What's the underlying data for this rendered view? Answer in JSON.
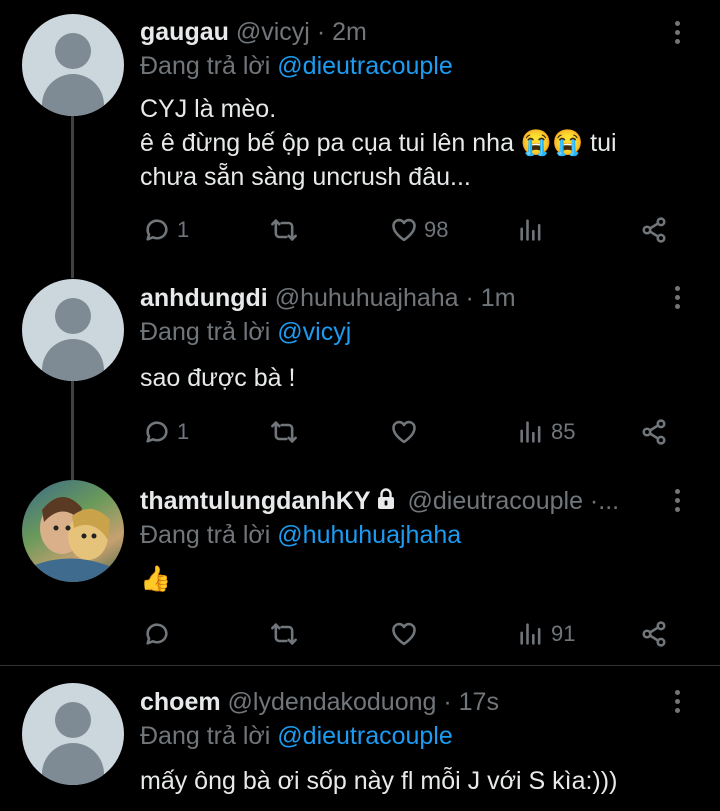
{
  "tweets": [
    {
      "name": "gaugau",
      "handle": "@vicyj",
      "time": "· 2m",
      "reply_prefix": "Đang trả lời ",
      "reply_to": "@dieutracouple",
      "text_lines": [
        "CYJ là mèo.",
        "ê ê đừng bế ộp pa cụa tui lên nha 😭😭 tui",
        "chưa sẵn sàng uncrush đâu..."
      ],
      "replies": "1",
      "likes": "98",
      "views": ""
    },
    {
      "name": "anhdungdi",
      "handle": "@huhuhuajhaha",
      "time": "· 1m",
      "reply_prefix": "Đang trả lời ",
      "reply_to": "@vicyj",
      "text_lines": [
        "sao được bà !"
      ],
      "replies": "1",
      "likes": "",
      "views": "85"
    },
    {
      "name": "thamtulungdanhKY",
      "handle": "@dieutracouple ·...",
      "time": "",
      "reply_prefix": "Đang trả lời ",
      "reply_to": "@huhuhuajhaha",
      "text_lines": [
        "👍"
      ],
      "replies": "",
      "likes": "",
      "views": "91"
    },
    {
      "name": "choem",
      "handle": "@lydendakoduong",
      "time": "· 17s",
      "reply_prefix": "Đang trả lời ",
      "reply_to": "@dieutracouple",
      "text_lines": [
        "mấy ông bà ơi sốp này fl mỗi J với S kìa:)))"
      ]
    }
  ],
  "colors": {
    "background": "#000000",
    "text": "#e7e9ea",
    "muted": "#71767b",
    "link": "#1d9bf0"
  },
  "icons": [
    "reply-icon",
    "retweet-icon",
    "like-icon",
    "views-icon",
    "share-icon",
    "more-icon",
    "lock-icon"
  ]
}
